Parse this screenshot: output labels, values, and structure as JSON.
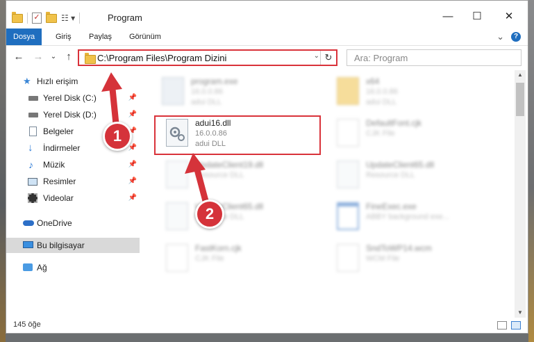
{
  "window": {
    "title": "Program",
    "minimize": "—",
    "maximize": "☐",
    "close": "✕"
  },
  "ribbon": {
    "tabs": [
      {
        "label": "Dosya",
        "active": true
      },
      {
        "label": "Giriş"
      },
      {
        "label": "Paylaş"
      },
      {
        "label": "Görünüm"
      }
    ],
    "expand": "⌄",
    "help": "?"
  },
  "nav": {
    "back": "←",
    "forward": "→",
    "recent": "⌄",
    "up": "↑",
    "address": "C:\\Program Files\\Program Dizini",
    "address_dropdown": "⌄",
    "refresh": "↻",
    "search_placeholder": "Ara: Program"
  },
  "sidebar": {
    "items": [
      {
        "label": "Hızlı erişim",
        "icon": "star-icon"
      },
      {
        "label": "Yerel Disk (C:)",
        "icon": "drive-icon",
        "pinned": true
      },
      {
        "label": "Yerel Disk (D:)",
        "icon": "drive-icon",
        "pinned": true
      },
      {
        "label": "Belgeler",
        "icon": "document-icon",
        "pinned": true
      },
      {
        "label": "İndirmeler",
        "icon": "download-icon",
        "pinned": true
      },
      {
        "label": "Müzik",
        "icon": "music-icon",
        "pinned": true
      },
      {
        "label": "Resimler",
        "icon": "pictures-icon",
        "pinned": true
      },
      {
        "label": "Videolar",
        "icon": "video-icon",
        "pinned": true
      },
      {
        "label": "OneDrive",
        "icon": "cloud-icon"
      },
      {
        "label": "Bu bilgisayar",
        "icon": "computer-icon",
        "selected": true
      },
      {
        "label": "Ağ",
        "icon": "network-icon"
      }
    ],
    "pin_glyph": "📌"
  },
  "files": [
    {
      "name": "program.exe",
      "line2": "16.0.0.86",
      "line3": "adui DLL",
      "icon": "exe-icon",
      "blurred": true
    },
    {
      "name": "x64",
      "line2": "16.0.0.86",
      "line3": "adui DLL",
      "icon": "folder-icon",
      "blurred": true
    },
    {
      "name": "adui16.dll",
      "line2": "16.0.0.86",
      "line3": "adui DLL",
      "icon": "dll-gear-icon",
      "blurred": false
    },
    {
      "name": "DefaultFont.cjk",
      "line2": "CJK File",
      "line3": "",
      "icon": "file-icon",
      "blurred": true
    },
    {
      "name": "UpdateClient19.dll",
      "line2": "Resource DLL",
      "line3": "",
      "icon": "dll-gear-icon",
      "blurred": true
    },
    {
      "name": "UpdateClient65.dll",
      "line2": "Resource DLL",
      "line3": "",
      "icon": "dll-gear-icon",
      "blurred": true
    },
    {
      "name": "UpdateClient65.dll",
      "line2": "Resource DLL",
      "line3": "",
      "icon": "dll-gear-icon",
      "blurred": true
    },
    {
      "name": "FineExec.exe",
      "line2": "ABBY background exe...",
      "line3": "",
      "icon": "exe-window-icon",
      "blurred": true
    },
    {
      "name": "FastKorn.cjk",
      "line2": "CJK File",
      "line3": "",
      "icon": "file-icon",
      "blurred": true
    },
    {
      "name": "SndToWP14.wcm",
      "line2": "WCM File",
      "line3": "",
      "icon": "file-icon",
      "blurred": true
    }
  ],
  "status": {
    "item_count": "145 öğe"
  },
  "callouts": {
    "step1": "1",
    "step2": "2"
  },
  "colors": {
    "accent": "#1f6ebf",
    "highlight_red": "#d9323a",
    "selected_bg": "#d9d9d9"
  }
}
